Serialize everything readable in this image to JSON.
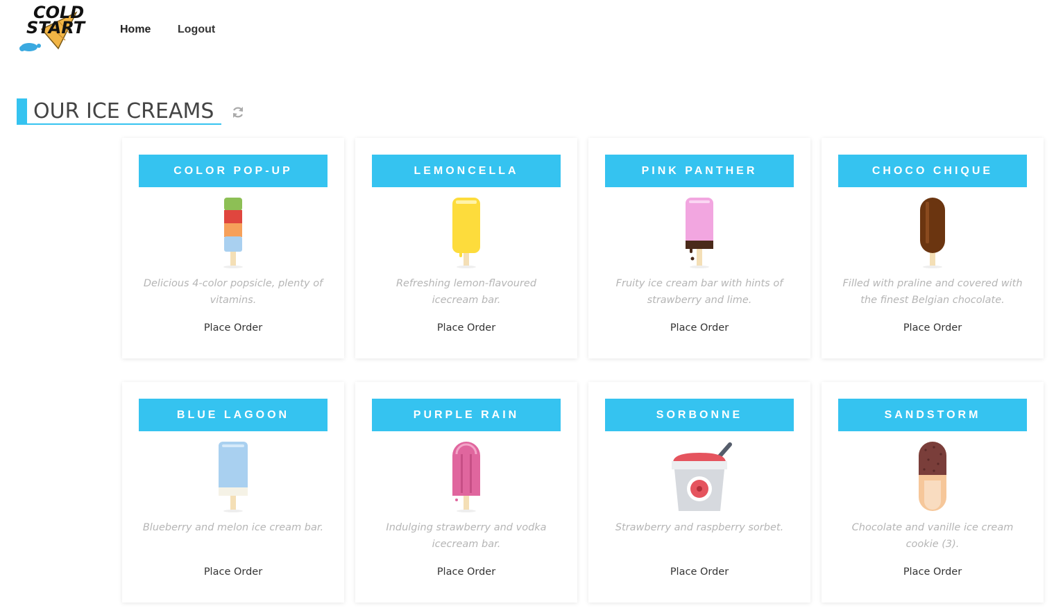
{
  "header": {
    "logo_text_line1": "COLD",
    "logo_text_line2": "START",
    "nav": {
      "home": "Home",
      "logout": "Logout"
    }
  },
  "section": {
    "title": "OUR ICE CREAMS",
    "refresh_icon": "refresh-icon"
  },
  "colors": {
    "accent": "#35c3f0",
    "title_text": "#ffffff",
    "description_text": "#b5b5b5"
  },
  "products": [
    {
      "name": "COLOR POP-UP",
      "description": "Delicious 4-color popsicle, plenty of vitamins.",
      "order_label": "Place Order",
      "icon": "color-popsicle-icon"
    },
    {
      "name": "LEMONCELLA",
      "description": "Refreshing lemon-flavoured icecream bar.",
      "order_label": "Place Order",
      "icon": "lemon-popsicle-icon"
    },
    {
      "name": "PINK PANTHER",
      "description": "Fruity ice cream bar with hints of strawberry and lime.",
      "order_label": "Place Order",
      "icon": "pink-popsicle-icon"
    },
    {
      "name": "CHOCO CHIQUE",
      "description": "Filled with praline and covered with the finest Belgian chocolate.",
      "order_label": "Place Order",
      "icon": "chocolate-popsicle-icon"
    },
    {
      "name": "BLUE LAGOON",
      "description": "Blueberry and melon ice cream bar.",
      "order_label": "Place Order",
      "icon": "blue-popsicle-icon"
    },
    {
      "name": "PURPLE RAIN",
      "description": "Indulging strawberry and vodka icecream bar.",
      "order_label": "Place Order",
      "icon": "purple-popsicle-icon"
    },
    {
      "name": "SORBONNE",
      "description": "Strawberry and raspberry sorbet.",
      "order_label": "Place Order",
      "icon": "sorbet-cup-icon"
    },
    {
      "name": "SANDSTORM",
      "description": "Chocolate and vanille ice cream cookie (3).",
      "order_label": "Place Order",
      "icon": "cookie-popsicle-icon"
    }
  ]
}
